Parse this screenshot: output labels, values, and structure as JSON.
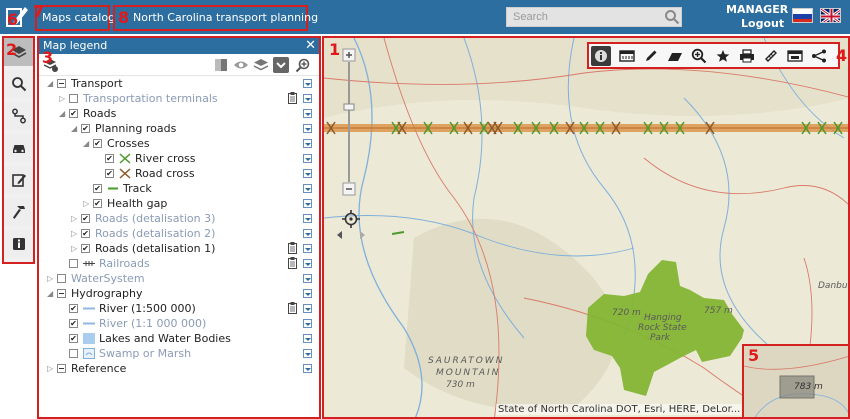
{
  "header": {
    "catalog_label": "Maps catalog",
    "map_title": "North Carolina transport planning",
    "search_placeholder": "Search",
    "user_name": "MANAGER",
    "logout_label": "Logout",
    "badge_logo": "6",
    "badge_catalog": "7",
    "badge_title": "8",
    "colors": {
      "bar": "#2d6ea0",
      "annotation": "#d42020"
    }
  },
  "toolbar": {
    "badge": "2",
    "icons": [
      "layers-icon",
      "search-icon",
      "route-icon",
      "car-icon",
      "edit-icon",
      "hammer-icon",
      "info-icon"
    ]
  },
  "legend": {
    "title": "Map legend",
    "badge": "3",
    "close": "✕",
    "items": [
      {
        "label": "Transport",
        "level": 0,
        "expand": "open",
        "check": "partial",
        "muted": false,
        "symbol": "none",
        "clip": false,
        "menu": true
      },
      {
        "label": "Transportation terminals",
        "level": 1,
        "expand": "closed",
        "check": "none",
        "muted": true,
        "symbol": "none",
        "clip": true,
        "menu": true
      },
      {
        "label": "Roads",
        "level": 1,
        "expand": "open",
        "check": "checked",
        "muted": false,
        "symbol": "none",
        "clip": false,
        "menu": true
      },
      {
        "label": "Planning roads",
        "level": 2,
        "expand": "open",
        "check": "checked",
        "muted": false,
        "symbol": "none",
        "clip": false,
        "menu": true
      },
      {
        "label": "Crosses",
        "level": 3,
        "expand": "open",
        "check": "checked",
        "muted": false,
        "symbol": "none",
        "clip": false,
        "menu": true
      },
      {
        "label": "River cross",
        "level": 4,
        "expand": "none",
        "check": "checked",
        "muted": false,
        "symbol": "green-x",
        "clip": false,
        "menu": true
      },
      {
        "label": "Road cross",
        "level": 4,
        "expand": "none",
        "check": "checked",
        "muted": false,
        "symbol": "brown-x",
        "clip": false,
        "menu": true
      },
      {
        "label": "Track",
        "level": 3,
        "expand": "none",
        "check": "checked",
        "muted": false,
        "symbol": "green-line",
        "clip": false,
        "menu": true
      },
      {
        "label": "Health gap",
        "level": 3,
        "expand": "closed",
        "check": "checked",
        "muted": false,
        "symbol": "none",
        "clip": false,
        "menu": true
      },
      {
        "label": "Roads (detalisation 3)",
        "level": 2,
        "expand": "closed",
        "check": "checked",
        "muted": true,
        "symbol": "none",
        "clip": false,
        "menu": true
      },
      {
        "label": "Roads (detalisation 2)",
        "level": 2,
        "expand": "closed",
        "check": "checked",
        "muted": true,
        "symbol": "none",
        "clip": false,
        "menu": true
      },
      {
        "label": "Roads (detalisation 1)",
        "level": 2,
        "expand": "closed",
        "check": "checked",
        "muted": false,
        "symbol": "none",
        "clip": true,
        "menu": true
      },
      {
        "label": "Railroads",
        "level": 1,
        "expand": "none",
        "check": "none",
        "muted": true,
        "symbol": "rail",
        "clip": true,
        "menu": true
      },
      {
        "label": "WaterSystem",
        "level": 0,
        "expand": "closed",
        "check": "none",
        "muted": true,
        "symbol": "none",
        "clip": false,
        "menu": true
      },
      {
        "label": "Hydrography",
        "level": 0,
        "expand": "open",
        "check": "partial",
        "muted": false,
        "symbol": "none",
        "clip": false,
        "menu": true
      },
      {
        "label": "River (1:500 000)",
        "level": 1,
        "expand": "none",
        "check": "checked",
        "muted": false,
        "symbol": "blue-line",
        "clip": true,
        "menu": true
      },
      {
        "label": "River (1:1 000 000)",
        "level": 1,
        "expand": "none",
        "check": "checked",
        "muted": true,
        "symbol": "blue-line",
        "clip": false,
        "menu": true
      },
      {
        "label": "Lakes and Water Bodies",
        "level": 1,
        "expand": "none",
        "check": "checked",
        "muted": false,
        "symbol": "blue-box",
        "clip": false,
        "menu": true
      },
      {
        "label": "Swamp or Marsh",
        "level": 1,
        "expand": "none",
        "check": "none",
        "muted": true,
        "symbol": "swamp",
        "clip": false,
        "menu": true
      },
      {
        "label": "Reference",
        "level": 0,
        "expand": "closed",
        "check": "partial",
        "muted": false,
        "symbol": "none",
        "clip": false,
        "menu": true
      }
    ]
  },
  "map": {
    "badge_map": "1",
    "badge_tools": "4",
    "badge_overview": "5",
    "attribution": "State of North Carolina DOT, Esri, HERE, DeLor...",
    "labels": {
      "danbury": "Danbury",
      "sauratown": "SAURATOWN",
      "mountain": "MOUNTAIN",
      "park_1": "Hanging",
      "park_2": "Rock State",
      "park_3": "Park",
      "elev_1": "720 m",
      "elev_2": "757 m",
      "elev_3": "783 m",
      "elev_4": "730 m"
    },
    "tools": [
      "info-icon",
      "measure-icon",
      "pencil-icon",
      "eraser-icon",
      "zoom-icon",
      "star-icon",
      "print-icon",
      "ruler-icon",
      "export-icon",
      "share-icon"
    ],
    "colors": {
      "park": "#84b534",
      "road": "#d98a3a",
      "river": "#6aa6d8"
    }
  }
}
